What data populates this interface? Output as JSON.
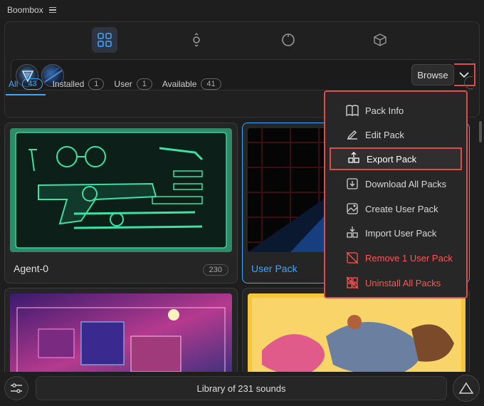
{
  "window": {
    "title": "Boombox"
  },
  "nav": {
    "tabs": [
      {
        "name": "grid-icon",
        "active": true
      },
      {
        "name": "search-icon",
        "active": false
      },
      {
        "name": "circle-icon",
        "active": false
      },
      {
        "name": "package-icon",
        "active": false
      }
    ]
  },
  "packbar": {
    "browse_label": "Browse"
  },
  "filters": [
    {
      "label": "All",
      "count": "43",
      "active": true
    },
    {
      "label": "Installed",
      "count": "1",
      "active": false
    },
    {
      "label": "User",
      "count": "1",
      "active": false
    },
    {
      "label": "Available",
      "count": "41",
      "active": false
    }
  ],
  "cards": [
    {
      "name": "Agent-0",
      "count": "230"
    },
    {
      "name": "User Pack",
      "count": ""
    }
  ],
  "dropdown_menu": {
    "items": [
      {
        "label": "Pack Info",
        "icon": "book-icon"
      },
      {
        "label": "Edit Pack",
        "icon": "edit-icon"
      },
      {
        "label": "Export Pack",
        "icon": "export-icon"
      },
      {
        "label": "Download All Packs",
        "icon": "download-icon"
      },
      {
        "label": "Create User Pack",
        "icon": "image-plus-icon"
      },
      {
        "label": "Import User Pack",
        "icon": "import-icon"
      },
      {
        "label": "Remove 1 User Pack",
        "icon": "image-off-icon"
      },
      {
        "label": "Uninstall All Packs",
        "icon": "uninstall-icon"
      }
    ]
  },
  "footer": {
    "library_text": "Library of 231 sounds"
  },
  "colors": {
    "accent": "#3ea6ff",
    "danger": "#ff5555",
    "highlight_border": "#e24b4b"
  }
}
